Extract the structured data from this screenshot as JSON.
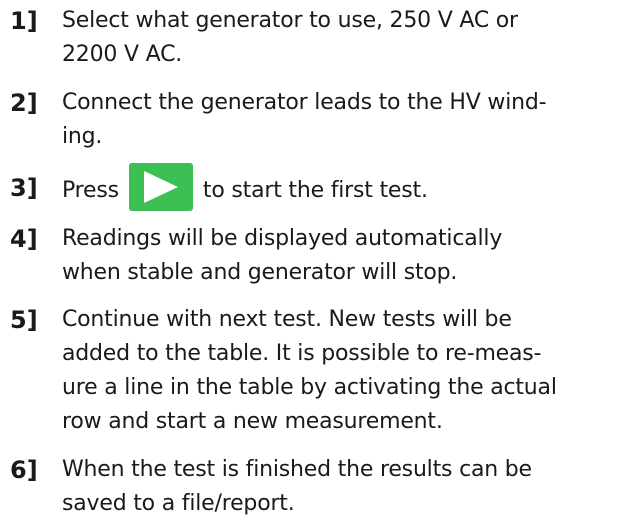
{
  "steps": [
    {
      "number": "1]",
      "lines": [
        "Select what generator to use, 250 V AC or",
        "2200 V AC."
      ]
    },
    {
      "number": "2]",
      "lines": [
        "Connect the generator leads to the HV wind-",
        "ing."
      ]
    },
    {
      "number": "3]",
      "before": "Press",
      "after": "to start the first test.",
      "icon": "play-icon"
    },
    {
      "number": "4]",
      "lines": [
        "Readings will be displayed automatically",
        "when stable and generator will stop."
      ]
    },
    {
      "number": "5]",
      "lines": [
        "Continue with next test. New tests will be",
        "added to the table. It is possible to re-meas-",
        "ure a line in the table by activating the actual",
        "row and start a new measurement."
      ]
    },
    {
      "number": "6]",
      "lines": [
        "When the test is finished the results can be",
        "saved to a file/report."
      ]
    }
  ],
  "colors": {
    "play_button": "#3dc053",
    "play_arrow": "#ffffff"
  }
}
